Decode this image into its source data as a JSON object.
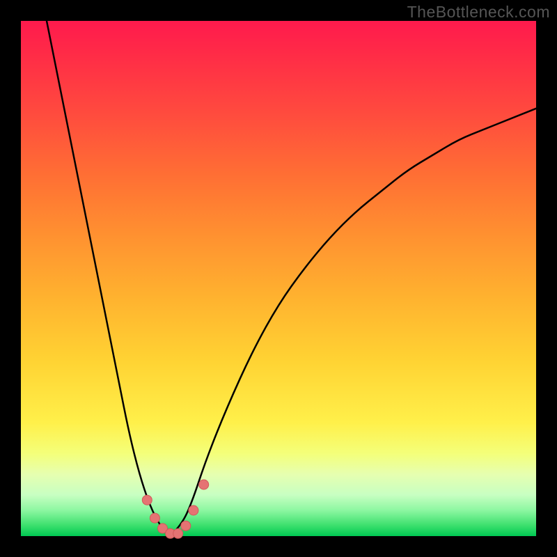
{
  "watermark": "TheBottleneck.com",
  "colors": {
    "frame": "#000000",
    "gradient_top": "#ff1a4d",
    "gradient_mid_orange": "#ff9230",
    "gradient_mid_yellow": "#fff04a",
    "gradient_bottom": "#00c853",
    "curve_stroke": "#000000",
    "marker_fill": "#e57373",
    "marker_stroke": "#d15a5a"
  },
  "chart_data": {
    "type": "line",
    "title": "",
    "xlabel": "",
    "ylabel": "",
    "xlim": [
      0,
      100
    ],
    "ylim": [
      0,
      100
    ],
    "curves": [
      {
        "name": "left_branch",
        "description": "Steep descending curve from top-left to valley",
        "points": [
          {
            "x": 5,
            "y": 100
          },
          {
            "x": 7,
            "y": 90
          },
          {
            "x": 9,
            "y": 80
          },
          {
            "x": 11,
            "y": 70
          },
          {
            "x": 13,
            "y": 60
          },
          {
            "x": 15,
            "y": 50
          },
          {
            "x": 17,
            "y": 40
          },
          {
            "x": 19,
            "y": 30
          },
          {
            "x": 21,
            "y": 20
          },
          {
            "x": 23,
            "y": 12
          },
          {
            "x": 25,
            "y": 6
          },
          {
            "x": 27,
            "y": 2
          },
          {
            "x": 29,
            "y": 0
          }
        ]
      },
      {
        "name": "right_branch",
        "description": "Rising curve from valley to upper-right, concave down",
        "points": [
          {
            "x": 29,
            "y": 0
          },
          {
            "x": 31,
            "y": 2
          },
          {
            "x": 33,
            "y": 6
          },
          {
            "x": 36,
            "y": 15
          },
          {
            "x": 40,
            "y": 25
          },
          {
            "x": 45,
            "y": 36
          },
          {
            "x": 50,
            "y": 45
          },
          {
            "x": 55,
            "y": 52
          },
          {
            "x": 60,
            "y": 58
          },
          {
            "x": 65,
            "y": 63
          },
          {
            "x": 70,
            "y": 67
          },
          {
            "x": 75,
            "y": 71
          },
          {
            "x": 80,
            "y": 74
          },
          {
            "x": 85,
            "y": 77
          },
          {
            "x": 90,
            "y": 79
          },
          {
            "x": 95,
            "y": 81
          },
          {
            "x": 100,
            "y": 83
          }
        ]
      }
    ],
    "markers": [
      {
        "x": 24.5,
        "y": 7
      },
      {
        "x": 26.0,
        "y": 3.5
      },
      {
        "x": 27.5,
        "y": 1.5
      },
      {
        "x": 29.0,
        "y": 0.5
      },
      {
        "x": 30.5,
        "y": 0.5
      },
      {
        "x": 32.0,
        "y": 2.0
      },
      {
        "x": 33.5,
        "y": 5.0
      },
      {
        "x": 35.5,
        "y": 10.0
      }
    ],
    "marker_radius": 7
  }
}
